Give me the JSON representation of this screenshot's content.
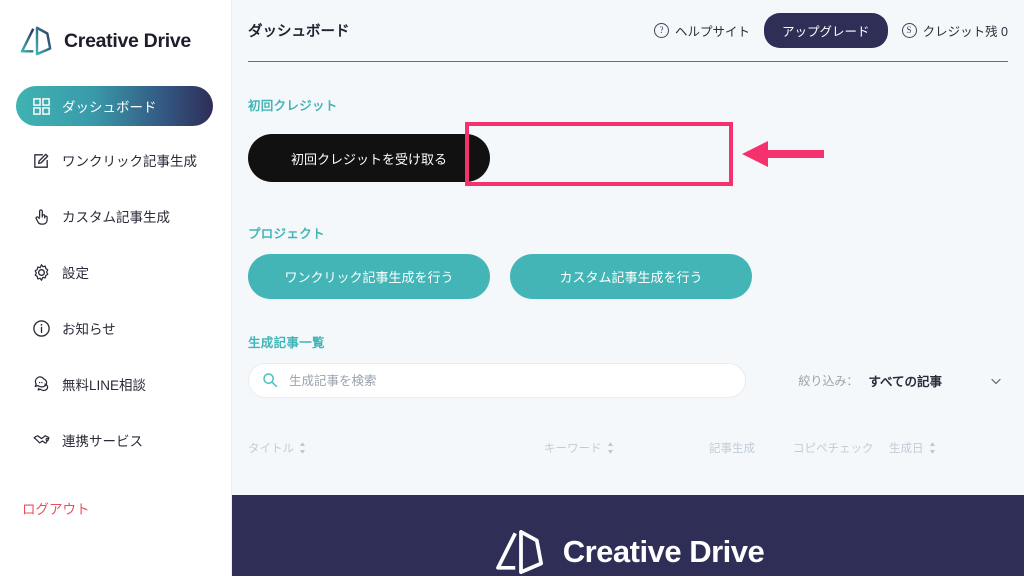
{
  "brand": {
    "name": "Creative Drive",
    "logo_icon": "cd-logo-icon"
  },
  "sidebar": {
    "items": [
      {
        "label": "ダッシュボード",
        "icon": "grid-icon",
        "active": true
      },
      {
        "label": "ワンクリック記事生成",
        "icon": "edit-square-icon",
        "active": false
      },
      {
        "label": "カスタム記事生成",
        "icon": "pointing-hand-icon",
        "active": false
      },
      {
        "label": "設定",
        "icon": "gear-icon",
        "active": false
      },
      {
        "label": "お知らせ",
        "icon": "info-circle-icon",
        "active": false
      },
      {
        "label": "無料LINE相談",
        "icon": "chat-bubbles-icon",
        "active": false
      },
      {
        "label": "連携サービス",
        "icon": "handshake-icon",
        "active": false
      }
    ],
    "logout_label": "ログアウト"
  },
  "header": {
    "title": "ダッシュボード",
    "help_label": "ヘルプサイト",
    "help_icon": "question-circle-icon",
    "upgrade_label": "アップグレード",
    "credit_label": "クレジット残 0",
    "credit_icon": "coin-circle-icon"
  },
  "first_credit": {
    "section_title": "初回クレジット",
    "button_label": "初回クレジットを受け取る"
  },
  "project": {
    "section_title": "プロジェクト",
    "one_click_label": "ワンクリック記事生成を行う",
    "custom_label": "カスタム記事生成を行う"
  },
  "article_list": {
    "section_title": "生成記事一覧",
    "search_placeholder": "生成記事を検索",
    "search_value": "",
    "search_icon": "search-icon",
    "filter_label": "絞り込み：",
    "filter_value": "すべての記事",
    "filter_icon": "chevron-down-icon",
    "columns": [
      {
        "label": "タイトル",
        "sortable": true
      },
      {
        "label": "キーワード",
        "sortable": true
      },
      {
        "label": "記事生成",
        "sortable": false
      },
      {
        "label": "コピペチェック",
        "sortable": false
      },
      {
        "label": "生成日",
        "sortable": true
      }
    ],
    "rows": []
  },
  "footer": {
    "brand": "Creative Drive",
    "logo_icon": "cd-logo-icon"
  },
  "annotation": {
    "type": "highlight-box-with-arrow",
    "color": "#f6326e",
    "target": "初回クレジットを受け取る"
  },
  "colors": {
    "teal": "#44b5b6",
    "navy": "#2e2e57",
    "accent_pink": "#f6326e",
    "logout_red": "#e8505b",
    "page_bg": "#f4f8fb"
  }
}
